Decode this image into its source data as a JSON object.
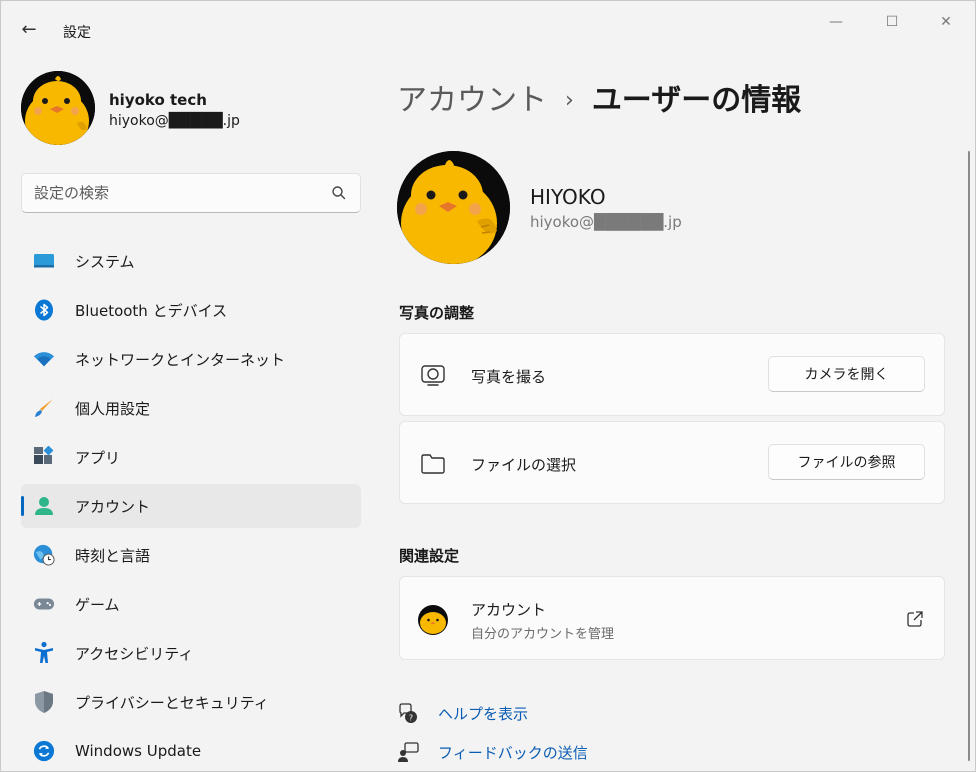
{
  "window": {
    "app_title": "設定",
    "back_glyph": "←",
    "controls": {
      "minimize": "—",
      "maximize": "☐",
      "close": "✕"
    }
  },
  "profile": {
    "name": "hiyoko tech",
    "email": "hiyoko@█████.jp"
  },
  "search": {
    "placeholder": "設定の検索"
  },
  "nav": [
    {
      "label": "システム",
      "icon": "monitor-icon"
    },
    {
      "label": "Bluetooth とデバイス",
      "icon": "bluetooth-icon"
    },
    {
      "label": "ネットワークとインターネット",
      "icon": "wifi-icon"
    },
    {
      "label": "個人用設定",
      "icon": "brush-icon"
    },
    {
      "label": "アプリ",
      "icon": "apps-icon"
    },
    {
      "label": "アカウント",
      "icon": "account-icon",
      "active": true
    },
    {
      "label": "時刻と言語",
      "icon": "globe-clock-icon"
    },
    {
      "label": "ゲーム",
      "icon": "gamepad-icon"
    },
    {
      "label": "アクセシビリティ",
      "icon": "accessibility-icon"
    },
    {
      "label": "プライバシーとセキュリティ",
      "icon": "shield-icon"
    },
    {
      "label": "Windows Update",
      "icon": "windows-update-icon"
    }
  ],
  "breadcrumb": {
    "parent": "アカウント",
    "separator": "›",
    "current": "ユーザーの情報"
  },
  "user": {
    "name": "HIYOKO",
    "email": "hiyoko@██████.jp"
  },
  "photo_section": {
    "title": "写真の調整",
    "take_photo": {
      "label": "写真を撮る",
      "button": "カメラを開く"
    },
    "choose_file": {
      "label": "ファイルの選択",
      "button": "ファイルの参照"
    }
  },
  "related": {
    "title": "関連設定",
    "account": {
      "label": "アカウント",
      "sub": "自分のアカウントを管理"
    }
  },
  "links": {
    "help": "ヘルプを表示",
    "feedback": "フィードバックの送信"
  },
  "colors": {
    "accent": "#0067c0",
    "link": "#0a5db5",
    "chick": "#f8b800"
  }
}
